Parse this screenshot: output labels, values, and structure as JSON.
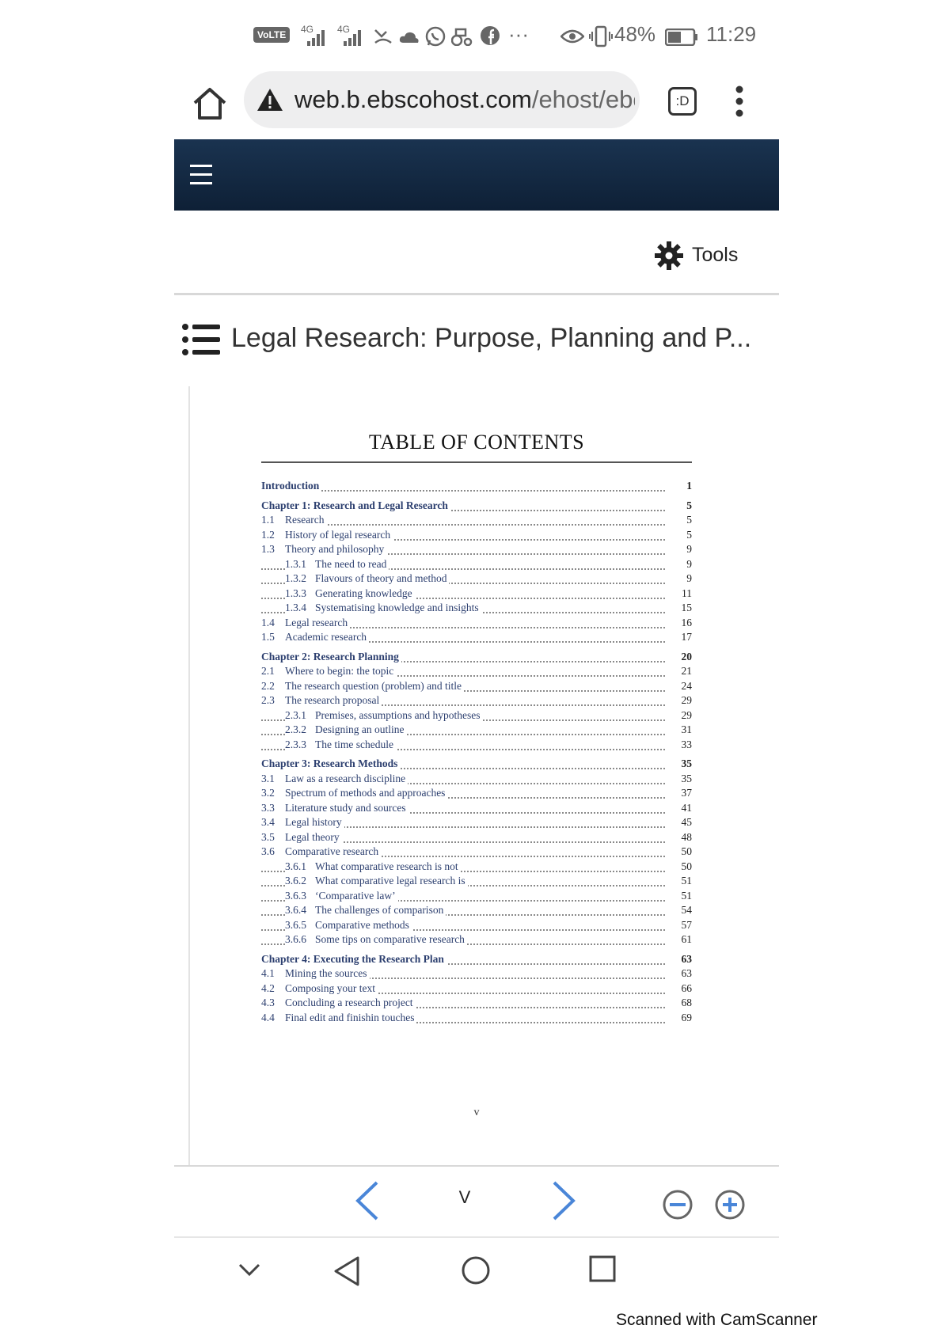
{
  "status_bar": {
    "volte": "VoLTE",
    "signal1": "4G",
    "signal2": "4G",
    "overflow": "···",
    "battery": "48%",
    "time": "11:29"
  },
  "browser": {
    "url_domain": "web.b.ebscohost.com",
    "url_path": "/ehost/eboc",
    "tab_label": ":D"
  },
  "toolbar": {
    "tools_label": "Tools"
  },
  "document": {
    "title": "Legal Research: Purpose, Planning and P..."
  },
  "toc": {
    "heading": "TABLE OF CONTENTS",
    "entries": [
      {
        "num": "",
        "label": "Introduction",
        "page": "1",
        "level": 0
      },
      {
        "num": "",
        "label": "Chapter 1: Research and Legal Research",
        "page": "5",
        "level": 0
      },
      {
        "num": "1.1",
        "label": "Research",
        "page": "5",
        "level": 1
      },
      {
        "num": "1.2",
        "label": "History of legal research",
        "page": "5",
        "level": 1
      },
      {
        "num": "1.3",
        "label": "Theory and philosophy",
        "page": "9",
        "level": 1
      },
      {
        "num": "1.3.1",
        "label": "The need to read",
        "page": "9",
        "level": 2
      },
      {
        "num": "1.3.2",
        "label": "Flavours of theory and method",
        "page": "9",
        "level": 2
      },
      {
        "num": "1.3.3",
        "label": "Generating knowledge",
        "page": "11",
        "level": 2
      },
      {
        "num": "1.3.4",
        "label": "Systematising knowledge and insights",
        "page": "15",
        "level": 2
      },
      {
        "num": "1.4",
        "label": "Legal research",
        "page": "16",
        "level": 1
      },
      {
        "num": "1.5",
        "label": "Academic research",
        "page": "17",
        "level": 1
      },
      {
        "num": "",
        "label": "Chapter 2: Research Planning",
        "page": "20",
        "level": 0
      },
      {
        "num": "2.1",
        "label": "Where to begin: the topic",
        "page": "21",
        "level": 1
      },
      {
        "num": "2.2",
        "label": "The research question (problem) and title",
        "page": "24",
        "level": 1
      },
      {
        "num": "2.3",
        "label": "The research proposal",
        "page": "29",
        "level": 1
      },
      {
        "num": "2.3.1",
        "label": "Premises, assumptions and hypotheses",
        "page": "29",
        "level": 2
      },
      {
        "num": "2.3.2",
        "label": "Designing an outline",
        "page": "31",
        "level": 2
      },
      {
        "num": "2.3.3",
        "label": "The time schedule",
        "page": "33",
        "level": 2
      },
      {
        "num": "",
        "label": "Chapter 3: Research Methods",
        "page": "35",
        "level": 0
      },
      {
        "num": "3.1",
        "label": "Law as a research discipline",
        "page": "35",
        "level": 1
      },
      {
        "num": "3.2",
        "label": "Spectrum of methods and approaches",
        "page": "37",
        "level": 1
      },
      {
        "num": "3.3",
        "label": "Literature study and sources",
        "page": "41",
        "level": 1
      },
      {
        "num": "3.4",
        "label": "Legal history",
        "page": "45",
        "level": 1
      },
      {
        "num": "3.5",
        "label": "Legal theory",
        "page": "48",
        "level": 1
      },
      {
        "num": "3.6",
        "label": "Comparative research",
        "page": "50",
        "level": 1
      },
      {
        "num": "3.6.1",
        "label": "What comparative research is not",
        "page": "50",
        "level": 2
      },
      {
        "num": "3.6.2",
        "label": "What comparative legal research is",
        "page": "51",
        "level": 2
      },
      {
        "num": "3.6.3",
        "label": "‘Comparative law’",
        "page": "51",
        "level": 2
      },
      {
        "num": "3.6.4",
        "label": "The challenges of comparison",
        "page": "54",
        "level": 2
      },
      {
        "num": "3.6.5",
        "label": "Comparative methods",
        "page": "57",
        "level": 2
      },
      {
        "num": "3.6.6",
        "label": "Some tips on comparative research",
        "page": "61",
        "level": 2
      },
      {
        "num": "",
        "label": "Chapter 4: Executing the Research Plan",
        "page": "63",
        "level": 0
      },
      {
        "num": "4.1",
        "label": "Mining the sources",
        "page": "63",
        "level": 1
      },
      {
        "num": "4.2",
        "label": "Composing your text",
        "page": "66",
        "level": 1
      },
      {
        "num": "4.3",
        "label": "Concluding a research project",
        "page": "68",
        "level": 1
      },
      {
        "num": "4.4",
        "label": "Final edit and finishin touches",
        "page": "69",
        "level": 1
      }
    ],
    "page_footer": "v"
  },
  "pager": {
    "current_page": "V"
  },
  "watermark": "Scanned with CamScanner",
  "colors": {
    "appbar": "#0e2036",
    "link": "#2c3f6f",
    "nav_blue": "#4a86d8"
  }
}
